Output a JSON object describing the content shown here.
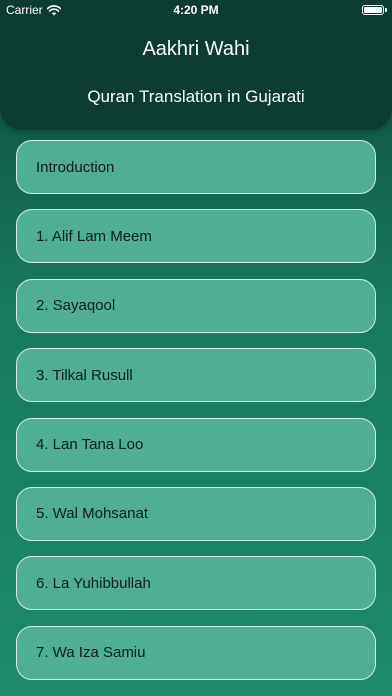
{
  "status_bar": {
    "carrier": "Carrier",
    "time": "4:20 PM",
    "wifi_icon": "wifi-icon",
    "battery_icon": "battery-icon"
  },
  "header": {
    "title": "Aakhri Wahi",
    "subtitle": "Quran Translation in Gujarati"
  },
  "chapters": [
    {
      "label": "Introduction"
    },
    {
      "label": "1. Alif Lam Meem"
    },
    {
      "label": "2. Sayaqool"
    },
    {
      "label": "3. Tilkal Rusull"
    },
    {
      "label": "4. Lan Tana Loo"
    },
    {
      "label": "5. Wal Mohsanat"
    },
    {
      "label": "6. La Yuhibbullah"
    },
    {
      "label": "7. Wa Iza Samiu"
    }
  ],
  "colors": {
    "header_bg": "#0c3b31",
    "item_bg": "#4fae93",
    "item_border": "#d7efe6",
    "text_dark": "#0b1f1a"
  }
}
